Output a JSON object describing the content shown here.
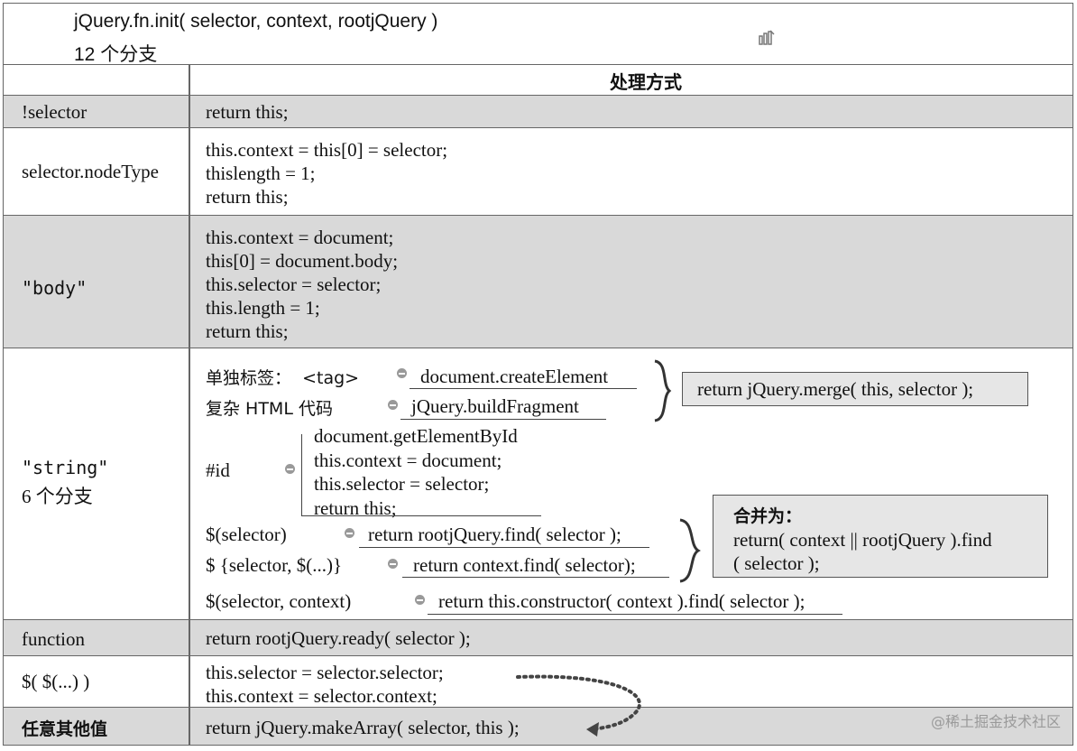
{
  "header": {
    "signature": "jQuery.fn.init( selector, context, rootjQuery )",
    "branches": "12 个分支",
    "icon": "chart-icon"
  },
  "column_header": "处理方式",
  "rows": [
    {
      "label": "!selector",
      "code": "return this;"
    },
    {
      "label": "selector.nodeType",
      "code": "this.context = this[0] = selector;\nthislength = 1;\nreturn this;"
    },
    {
      "label": "\"body\"",
      "code": "this.context = document;\nthis[0] = document.body;\nthis.selector = selector;\nthis.length = 1;\nreturn this;"
    },
    {
      "label": "\"string\"",
      "sublabel": "6 个分支"
    },
    {
      "label": "function",
      "code": "return rootjQuery.ready( selector );"
    },
    {
      "label": "$( $(...) )",
      "code": "this.selector = selector.selector;\nthis.context = selector.context;"
    },
    {
      "label": "任意其他值",
      "code": "return jQuery.makeArray( selector, this );"
    }
  ],
  "string_branches": {
    "single_tag_label": "单独标签：  <tag>",
    "single_tag_code": "document.createElement",
    "complex_html_label": "复杂 HTML 代码",
    "complex_html_code": "jQuery.buildFragment",
    "merge_result": "return jQuery.merge( this, selector );",
    "id_label": "#id",
    "id_code": "document.getElementById\nthis.context = document;\nthis.selector = selector;\nreturn this;",
    "sel_label": "$(selector)",
    "sel_code": "return rootjQuery.find( selector );",
    "selctx_label": "$ {selector, $(...)}",
    "selctx_code": "return context.find( selector);",
    "combined_title": "合并为：",
    "combined_code": "return( context || rootjQuery ).find\n( selector );",
    "ctx_label": "$(selector, context)",
    "ctx_code": "return this.constructor( context ).find( selector );"
  },
  "watermark": "@稀土掘金技术社区"
}
